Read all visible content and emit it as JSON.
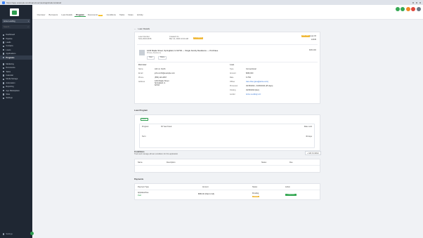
{
  "browser": {
    "url": "https://app.example.com/loans/overview/applications/detail",
    "colors": {
      "bar": "#dfe3ea"
    }
  },
  "sidebar": {
    "org_name": "Acme Lending",
    "search_placeholder": "Search...",
    "items": [
      {
        "label": "Dashboard",
        "icon": "grid-icon"
      },
      {
        "label": "Pipeline",
        "icon": "funnel-icon"
      },
      {
        "label": "Leads",
        "icon": "user-icon"
      },
      {
        "label": "Contacts",
        "icon": "contact-icon"
      },
      {
        "label": "Loans",
        "icon": "money-icon"
      },
      {
        "label": "Applications",
        "icon": "file-icon"
      },
      {
        "label": "Programs",
        "icon": "folder-icon",
        "active": true
      },
      {
        "label": "Marketing",
        "icon": "megaphone-icon"
      },
      {
        "label": "Documents",
        "icon": "doc-icon"
      },
      {
        "label": "Tasks",
        "icon": "check-icon"
      },
      {
        "label": "Calendar",
        "icon": "calendar-icon"
      },
      {
        "label": "Media Storage",
        "icon": "media-icon"
      },
      {
        "label": "Automation",
        "icon": "bolt-icon"
      },
      {
        "label": "Reporting",
        "icon": "chart-icon"
      },
      {
        "label": "App Marketplace",
        "icon": "store-icon"
      },
      {
        "label": "Sites",
        "icon": "globe-icon"
      },
      {
        "label": "Settings",
        "icon": "gear-icon"
      }
    ],
    "footer_label": "Settings",
    "colors": {
      "bg": "#1f2733",
      "accent": "#2e9d4f"
    }
  },
  "topbar": {
    "tabs": [
      {
        "label": "Overview",
        "active": false
      },
      {
        "label": "Borrowers",
        "active": false
      },
      {
        "label": "Loan Details",
        "active": false
      },
      {
        "label": "Program",
        "active": true
      },
      {
        "label": "Documents",
        "active": false,
        "badge": "New"
      },
      {
        "label": "Conditions",
        "active": false
      },
      {
        "label": "Tasks",
        "active": false
      },
      {
        "label": "Notes",
        "active": false
      },
      {
        "label": "Activity",
        "active": false
      }
    ],
    "icon_colors": [
      "#35a853",
      "#35a853",
      "#f08a24",
      "#e0463a",
      "#6b7785"
    ]
  },
  "breadcrumb": {
    "back": "←",
    "label": "Loan Details"
  },
  "loan_card": {
    "header_left_1": "Loan Number",
    "header_left_2": "SLG-2024-0156",
    "header_mid_1": "Created On",
    "header_mid_2": "Mar 12, 2024 10:24 AM",
    "status": "In Progress",
    "edit_label": "Edit Loan",
    "header_right_1": "Loan ID",
    "header_right_2": "12345",
    "property_title": "1234 Maple Street, Springfield, IL 62704 — Single Family Residence — Purchase",
    "property_sub": "Primary Residence",
    "property_right": "$450,000",
    "btn_1": "View",
    "btn_2": "Share",
    "borrower_heading": "Borrower",
    "borrower": [
      {
        "k": "Name",
        "v": "John A. Smith"
      },
      {
        "k": "Email",
        "v": "john.smith@example.com"
      },
      {
        "k": "Phone",
        "v": "(555) 123-4567"
      },
      {
        "k": "Address",
        "v": [
          "1234 Maple Street",
          "Springfield, IL",
          "62704"
        ]
      }
    ],
    "loan_heading": "Loan",
    "loan": [
      {
        "k": "Type",
        "v": "Conventional",
        "link": false
      },
      {
        "k": "Amount",
        "v": "$360,000",
        "link": false
      },
      {
        "k": "Rate",
        "v": "6.75%",
        "link": false
      },
      {
        "k": "Officer",
        "v": "Jane Doe (jane@acme.com)",
        "link": true
      },
      {
        "k": "Processor",
        "v": "03/15/2024 - 04/30/2024 (45 days)",
        "link": false
      },
      {
        "k": "Closing",
        "v": "04/30/2024 (Est.)",
        "link": false
      },
      {
        "k": "Lender",
        "v": "Acme Lending LLC",
        "link": true
      }
    ]
  },
  "program_card": {
    "title": "Loan Program",
    "tag": "Active",
    "inner_label": "Program",
    "inner_value": "30 Year Fixed",
    "inner_right": "Rate Lock",
    "inner_bottom_left": "Term",
    "inner_bottom_right": "30 days"
  },
  "conditions": {
    "title": "Conditions",
    "subtitle": "Track and manage all loan conditions for this application",
    "add_label": "+ Add Condition",
    "columns": [
      "Name",
      "Description",
      "Status",
      "Due"
    ]
  },
  "payments": {
    "title": "Payments",
    "columns": [
      "Payment Type",
      "Amount",
      "Status",
      "Action"
    ],
    "row": {
      "type": "Appraisal Fee",
      "type_sub": "Paid",
      "amount": "$550.00 (Paid in full)",
      "status": "Pending",
      "status_badge": "Review",
      "action": "Completed"
    }
  }
}
